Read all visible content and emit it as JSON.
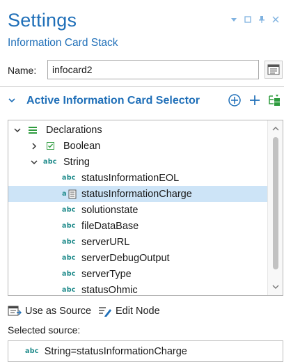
{
  "header": {
    "title": "Settings",
    "subtitle": "Information Card Stack",
    "controls": [
      "dropdown-arrow-icon",
      "restore-icon",
      "pin-icon",
      "close-icon"
    ]
  },
  "name_field": {
    "label": "Name:",
    "value": "infocard2"
  },
  "section": {
    "title": "Active Information Card Selector",
    "buttons": [
      "add-circle-icon",
      "add-icon",
      "add-from-tree-icon"
    ]
  },
  "tree": {
    "root": {
      "label": "Declarations",
      "icon": "declarations-icon",
      "expanded": true
    },
    "boolean": {
      "label": "Boolean",
      "icon": "boolean-icon",
      "expanded": false
    },
    "string": {
      "label": "String",
      "icon": "abc-icon",
      "expanded": true,
      "prefix": "abc"
    },
    "items": [
      {
        "label": "statusInformationEOL",
        "prefix": "abc",
        "selected": false
      },
      {
        "label": "statusInformationCharge",
        "prefix": "abc",
        "selected": true
      },
      {
        "label": "solutionstate",
        "prefix": "abc",
        "selected": false
      },
      {
        "label": "fileDataBase",
        "prefix": "abc",
        "selected": false
      },
      {
        "label": "serverURL",
        "prefix": "abc",
        "selected": false
      },
      {
        "label": "serverDebugOutput",
        "prefix": "abc",
        "selected": false
      },
      {
        "label": "serverType",
        "prefix": "abc",
        "selected": false
      },
      {
        "label": "statusOhmic",
        "prefix": "abc",
        "selected": false
      }
    ]
  },
  "actions": {
    "use_as_source": "Use as Source",
    "edit_node": "Edit Node"
  },
  "selected_source": {
    "label": "Selected source:",
    "prefix": "abc",
    "value": "String=statusInformationCharge"
  },
  "colors": {
    "accent": "#1f6fb8",
    "abc": "#1e8a8a",
    "selection": "#cde4f7",
    "green": "#2e9b3e"
  }
}
